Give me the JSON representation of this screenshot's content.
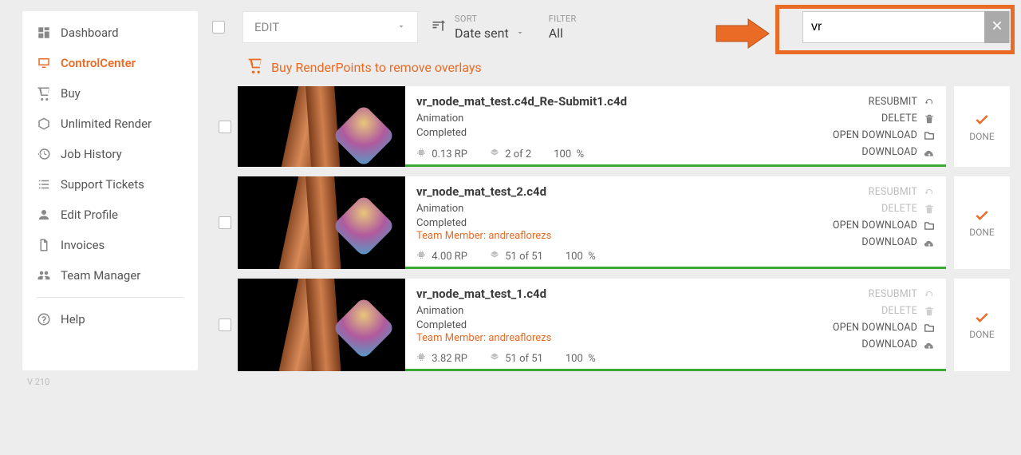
{
  "sidebar": {
    "items": [
      {
        "label": "Dashboard",
        "icon": "grid"
      },
      {
        "label": "ControlCenter",
        "icon": "monitor",
        "active": true
      },
      {
        "label": "Buy",
        "icon": "cart"
      },
      {
        "label": "Unlimited Render",
        "icon": "cube"
      },
      {
        "label": "Job History",
        "icon": "history"
      },
      {
        "label": "Support Tickets",
        "icon": "list"
      },
      {
        "label": "Edit Profile",
        "icon": "user"
      },
      {
        "label": "Invoices",
        "icon": "doc"
      },
      {
        "label": "Team Manager",
        "icon": "team"
      }
    ],
    "help_label": "Help",
    "version": "V 210"
  },
  "toolbar": {
    "edit_label": "EDIT",
    "sort_label": "SORT",
    "sort_value": "Date sent",
    "filter_label": "FILTER",
    "filter_value": "All",
    "search_value": "vr"
  },
  "buy_banner": {
    "text": "Buy RenderPoints to remove overlays"
  },
  "action_labels": {
    "resubmit": "RESUBMIT",
    "delete": "DELETE",
    "open_download": "OPEN DOWNLOAD",
    "download": "DOWNLOAD",
    "done": "DONE"
  },
  "jobs": [
    {
      "title": "vr_node_mat_test.c4d_Re-Submit1.c4d",
      "type": "Animation",
      "status": "Completed",
      "team_member": null,
      "rp": "0.13 RP",
      "frames": "2 of 2",
      "percent": "100",
      "resubmit_enabled": true,
      "delete_enabled": true
    },
    {
      "title": "vr_node_mat_test_2.c4d",
      "type": "Animation",
      "status": "Completed",
      "team_member": "Team Member: andreaflorezs",
      "rp": "4.00 RP",
      "frames": "51 of 51",
      "percent": "100",
      "resubmit_enabled": false,
      "delete_enabled": false
    },
    {
      "title": "vr_node_mat_test_1.c4d",
      "type": "Animation",
      "status": "Completed",
      "team_member": "Team Member: andreaflorezs",
      "rp": "3.82 RP",
      "frames": "51 of 51",
      "percent": "100",
      "resubmit_enabled": false,
      "delete_enabled": false
    }
  ]
}
